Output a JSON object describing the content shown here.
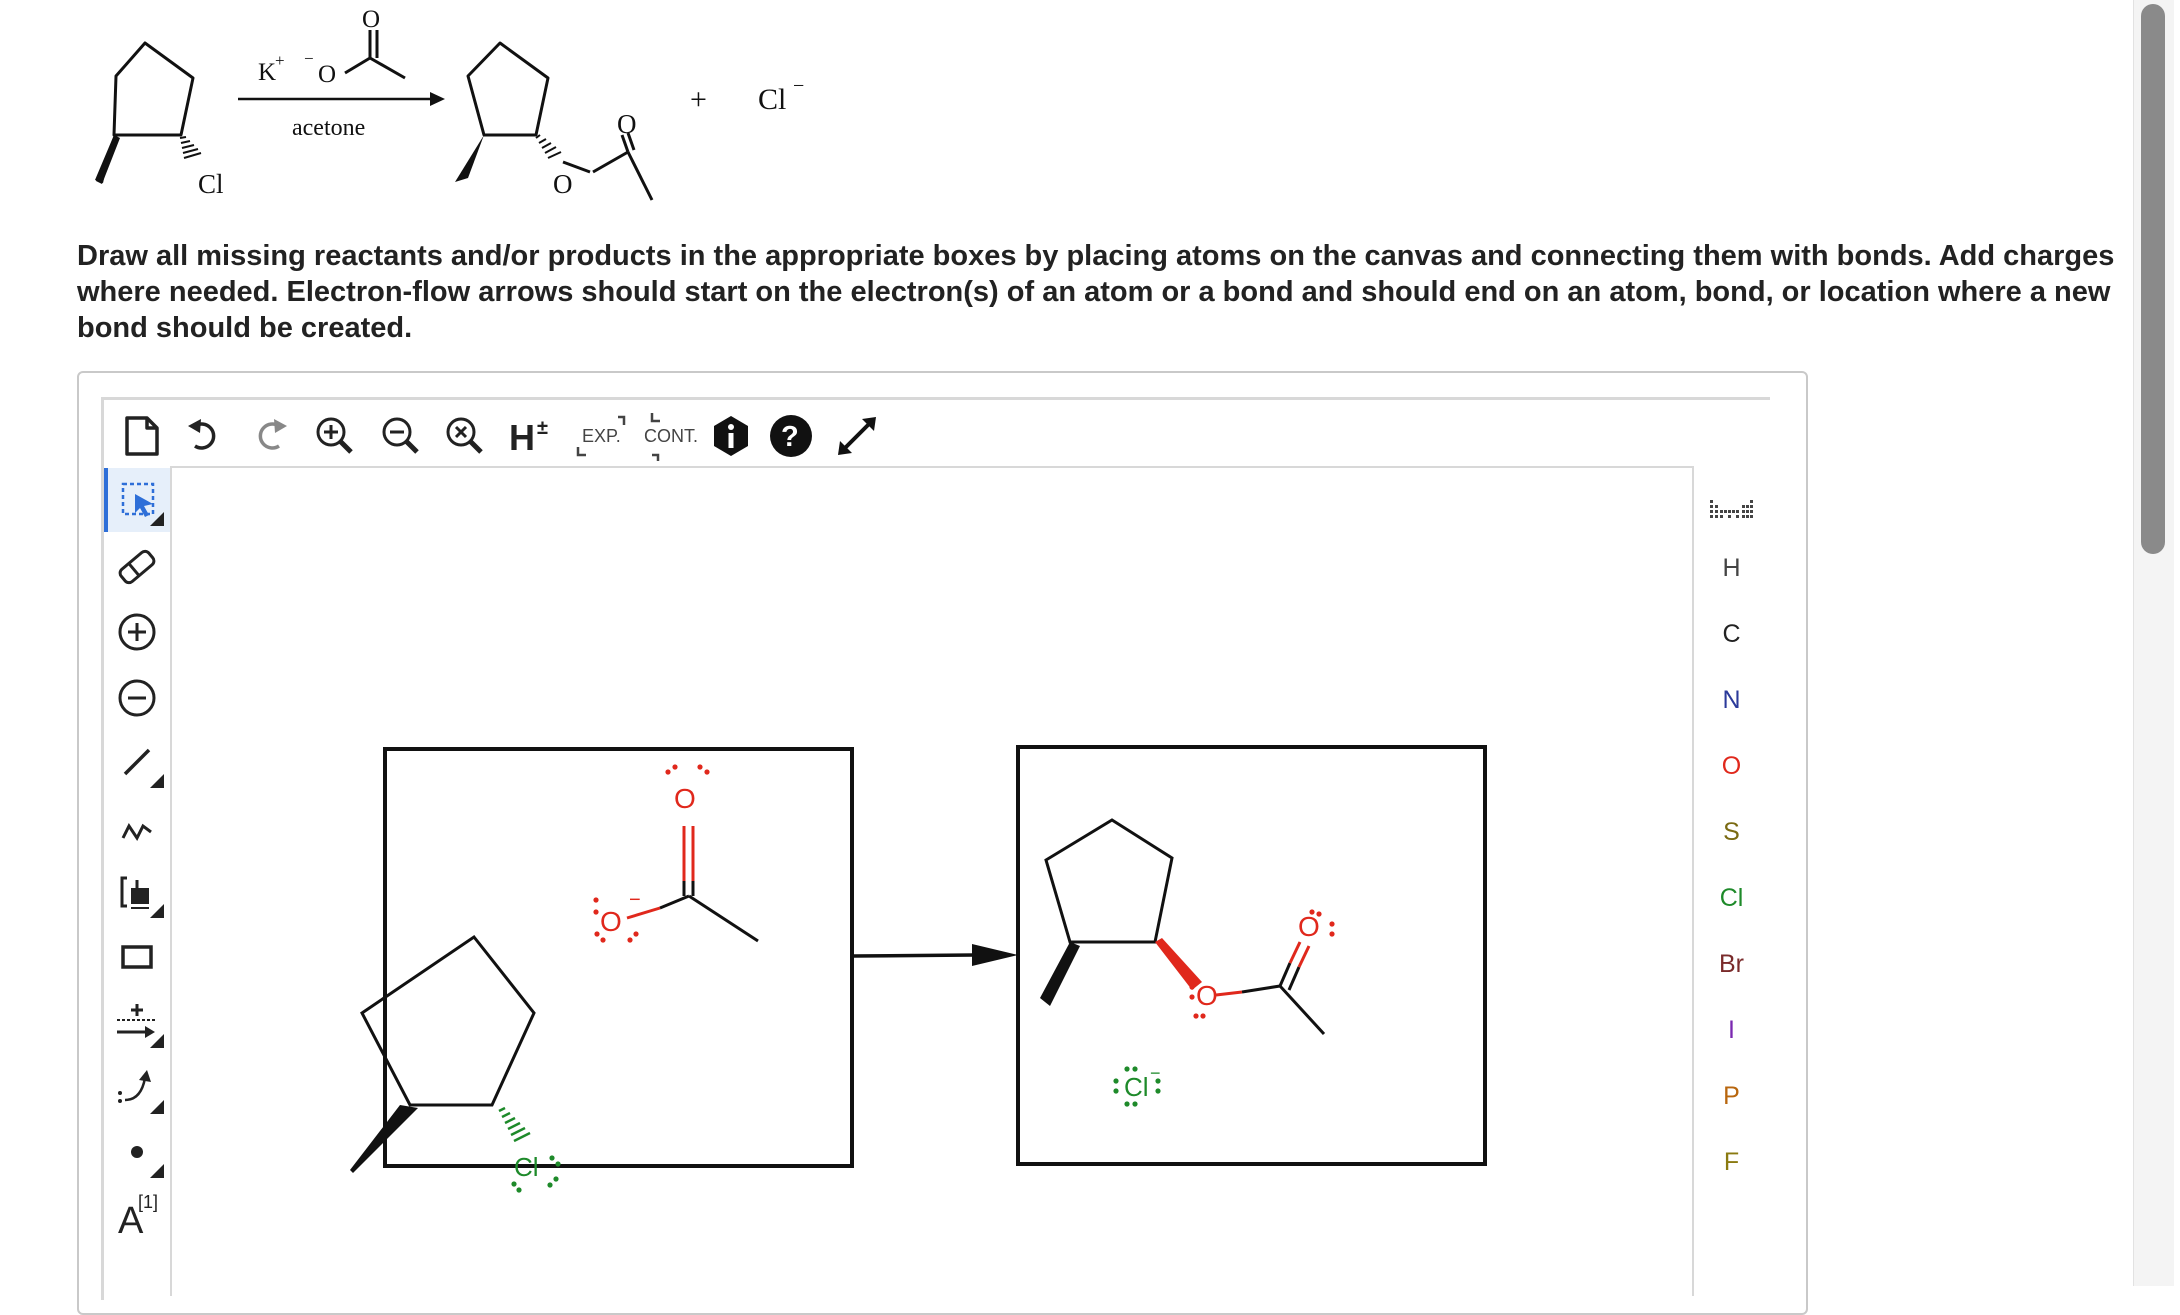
{
  "scheme": {
    "reagent_cation": "K",
    "reagent_cation_charge": "+",
    "reagent_anion_charge": "−",
    "reagent_O": "O",
    "reagent_carbonyl_O": "O",
    "solvent": "acetone",
    "reactant_Cl": "Cl",
    "product_ester_O": "O",
    "product_carbonyl_O": "O",
    "plus": "+",
    "byproduct": "Cl",
    "byproduct_charge": "−"
  },
  "instructions": "Draw all missing reactants and/or products in the appropriate boxes by placing atoms on the canvas and connecting them with bonds. Add charges where needed. Electron-flow arrows should start on the electron(s) of an atom or a bond and should end on an atom, bond, or location where a new bond should be created.",
  "top_toolbar": {
    "exp_label": "EXP.",
    "cont_label": "CONT."
  },
  "left_toolbar": {
    "atom_label_tool": "A",
    "atom_label_index": "[1]"
  },
  "canvas": {
    "box1_carbonyl_O": "O",
    "box1_anion_O": "O",
    "box1_anion_charge": "−",
    "box1_Cl": "Cl",
    "box2_carbonyl_O": "O",
    "box2_ester_O": "O",
    "box2_Cl": "Cl",
    "box2_Cl_charge": "−"
  },
  "atoms": [
    {
      "symbol": "H",
      "color": "#444444"
    },
    {
      "symbol": "C",
      "color": "#222222"
    },
    {
      "symbol": "N",
      "color": "#2b3a9a"
    },
    {
      "symbol": "O",
      "color": "#e0281c"
    },
    {
      "symbol": "S",
      "color": "#7a6a12"
    },
    {
      "symbol": "Cl",
      "color": "#1e8a2a"
    },
    {
      "symbol": "Br",
      "color": "#7a2b2b"
    },
    {
      "symbol": "I",
      "color": "#7a28b0"
    },
    {
      "symbol": "P",
      "color": "#b8660e"
    },
    {
      "symbol": "F",
      "color": "#8a7a10"
    }
  ],
  "colors": {
    "oxygen": "#e0281c",
    "chlorine": "#1e8a2a",
    "active_tool": "#2e6fd8"
  }
}
